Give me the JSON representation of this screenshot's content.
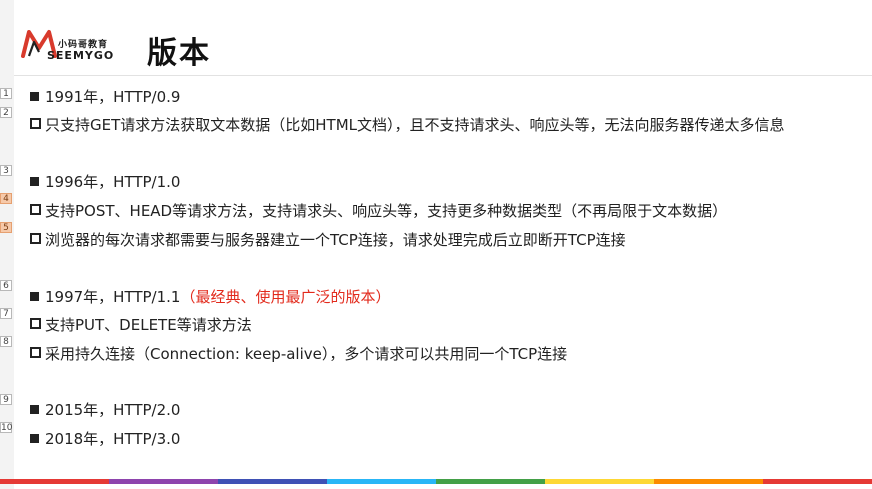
{
  "slide": {
    "title": "版本",
    "logo": {
      "cn": "小码哥教育",
      "en": "SEEMYGO"
    },
    "line_numbers": [
      "1",
      "2",
      "3",
      "4",
      "5",
      "6",
      "7",
      "8",
      "9",
      "10"
    ],
    "sections": [
      {
        "heading": "1991年，HTTP/0.9",
        "items": [
          "只支持GET请求方法获取文本数据（比如HTML文档），且不支持请求头、响应头等，无法向服务器传递太多信息"
        ]
      },
      {
        "heading": "1996年，HTTP/1.0",
        "items": [
          "支持POST、HEAD等请求方法，支持请求头、响应头等，支持更多种数据类型（不再局限于文本数据）",
          "浏览器的每次请求都需要与服务器建立一个TCP连接，请求处理完成后立即断开TCP连接"
        ]
      },
      {
        "heading": "1997年，HTTP/1.1",
        "heading_note_open": "（",
        "heading_note": "最经典、使用最广泛的版本",
        "heading_note_close": "）",
        "items": [
          "支持PUT、DELETE等请求方法",
          "采用持久连接（Connection: keep-alive），多个请求可以共用同一个TCP连接"
        ]
      },
      {
        "heading": "2015年，HTTP/2.0"
      },
      {
        "heading": "2018年，HTTP/3.0"
      }
    ]
  },
  "colors": {
    "highlight": "#e22a1c",
    "logo_red": "#d83a2c",
    "bottom_bar": [
      "#e53935",
      "#8e44ad",
      "#3f51b5",
      "#29b6f6",
      "#43a047",
      "#fdd835",
      "#fb8c00",
      "#e53935"
    ]
  }
}
